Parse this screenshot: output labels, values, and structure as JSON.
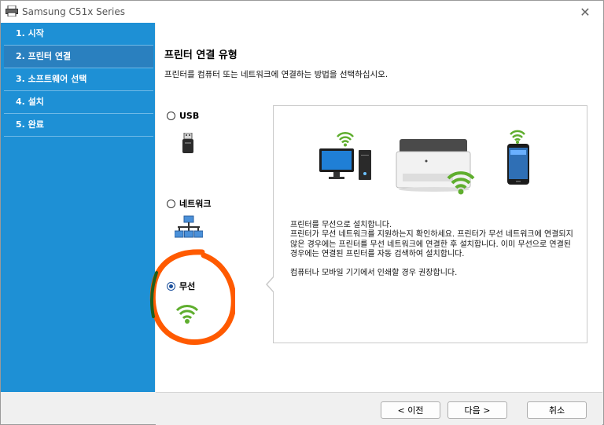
{
  "window": {
    "title": "Samsung C51x Series",
    "close_glyph": "✕"
  },
  "sidebar": {
    "steps": [
      {
        "label": "1. 시작"
      },
      {
        "label": "2. 프린터 연결"
      },
      {
        "label": "3. 소프트웨어 선택"
      },
      {
        "label": "4. 설치"
      },
      {
        "label": "5. 완료"
      }
    ],
    "active_step": 1,
    "color": "#1e90d5"
  },
  "main": {
    "heading": "프린터 연결 유형",
    "subtitle": "프린터를 컴퓨터 또는 네트워크에 연결하는 방법을 선택하십시오.",
    "options": [
      {
        "label": "USB",
        "icon": "usb-plug-icon",
        "selected": false
      },
      {
        "label": "네트워크",
        "icon": "network-icon",
        "selected": false
      },
      {
        "label": "무선",
        "icon": "wifi-icon",
        "selected": true
      }
    ],
    "panel": {
      "icons": [
        "wifi-icon",
        "desktop-computer-icon",
        "printer-icon",
        "smartphone-icon"
      ],
      "description_1": "프린터를 무선으로 설치합니다.",
      "description_2": "프린터가 무선 네트워크를 지원하는지 확인하세요. 프린터가 무선 네트워크에 연결되지 않은 경우에는 프린터를 무선 네트워크에 연결한 후 설치합니다. 이미 무선으로 연결된 경우에는 연결된 프린터를 자동 검색하여 설치합니다.",
      "recommend": "컴퓨터나 모바일 기기에서 인쇄할 경우 권장합니다."
    }
  },
  "footer": {
    "back_label": "< 이전",
    "next_label": "다음 >",
    "cancel_label": "취소"
  },
  "annotation": {
    "color": "#ff5a00",
    "accent": "#1e5e1e"
  }
}
